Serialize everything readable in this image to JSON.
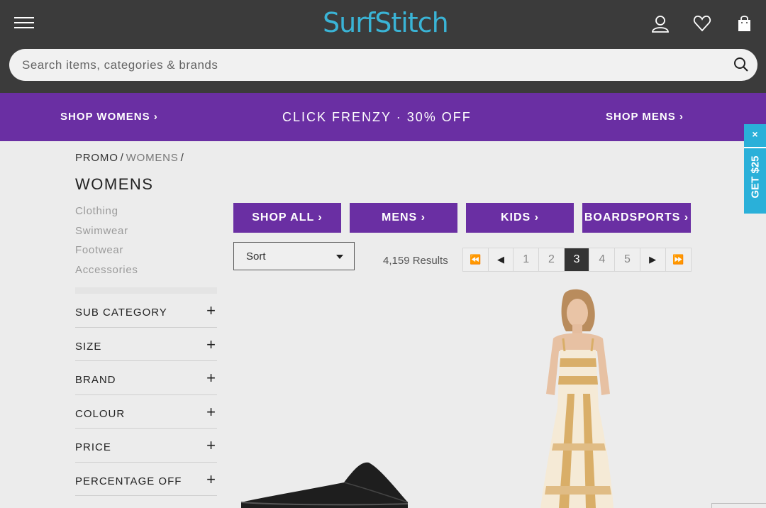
{
  "header": {
    "logo": "SurfStitch",
    "search": {
      "placeholder": "Search items, categories & brands",
      "value": ""
    }
  },
  "promo_band": {
    "shop_womens": "SHOP WOMENS ›",
    "center": "CLICK FRENZY · 30% OFF",
    "shop_mens": "SHOP MENS ›"
  },
  "side_tab": {
    "close": "×",
    "label": "GET $25"
  },
  "breadcrumb": [
    "PROMO",
    "WOMENS"
  ],
  "page_title": "WOMENS",
  "categories": [
    "Clothing",
    "Swimwear",
    "Footwear",
    "Accessories"
  ],
  "filters": [
    "SUB CATEGORY",
    "SIZE",
    "BRAND",
    "COLOUR",
    "PRICE",
    "PERCENTAGE OFF"
  ],
  "filter_toggle": "+",
  "category_buttons": [
    "SHOP ALL ›",
    "MENS ›",
    "KIDS ›",
    "BOARDSPORTS ›"
  ],
  "sort": {
    "selected": "Sort"
  },
  "results": "4,159 Results",
  "pagination": {
    "pages": [
      "1",
      "2",
      "3",
      "4",
      "5"
    ],
    "current": "3",
    "first": "⏪",
    "prev": "◀",
    "next": "▶",
    "last": "⏩"
  },
  "colors": {
    "header_bg": "#3b3b3b",
    "brand_purple": "#6a2fa3",
    "logo_blue": "#3ab4d6",
    "tab_blue": "#2ab0d9"
  }
}
